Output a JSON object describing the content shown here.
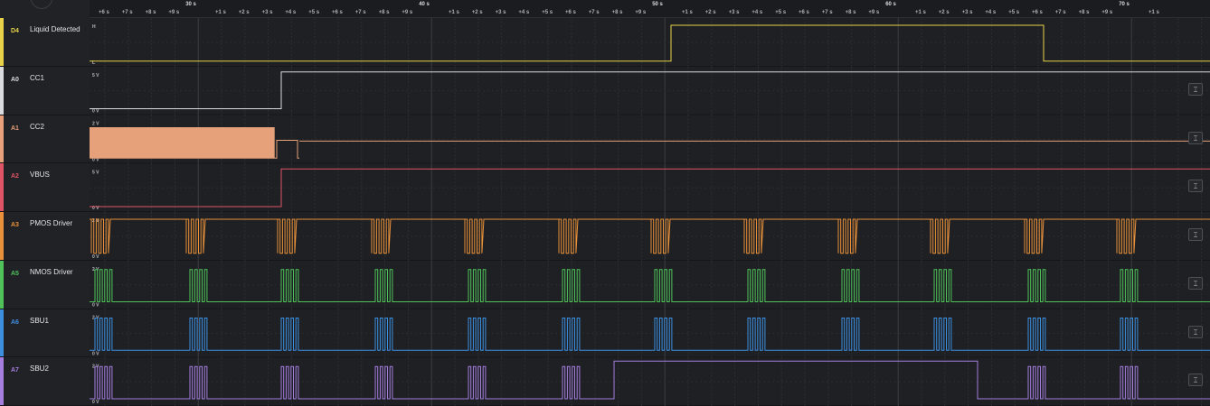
{
  "timeline": {
    "major": [
      "30 s",
      "40 s",
      "50 s",
      "60 s",
      "70 s"
    ],
    "minor": [
      "+6 s",
      "+7 s",
      "+8 s",
      "+9 s",
      "+1 s",
      "+2 s",
      "+3 s",
      "+4 s",
      "+5 s",
      "+6 s",
      "+7 s",
      "+8 s",
      "+9 s",
      "+1 s",
      "+2 s",
      "+3 s",
      "+4 s",
      "+5 s",
      "+6 s",
      "+7 s",
      "+8 s",
      "+9 s",
      "+1 s",
      "+2 s",
      "+3 s",
      "+4 s",
      "+5 s",
      "+6 s",
      "+7 s",
      "+8 s",
      "+9 s",
      "+1 s",
      "+2 s",
      "+3 s",
      "+4 s",
      "+5 s",
      "+6 s",
      "+7 s",
      "+8 s",
      "+9 s",
      "+1 s"
    ]
  },
  "channels": [
    {
      "id": "D4",
      "name": "Liquid Detected",
      "color": "#e8d24a",
      "hi_label": "H",
      "lo_label": "L",
      "type": "digital",
      "expand_icon": false
    },
    {
      "id": "A0",
      "name": "CC1",
      "color": "#d9dbdf",
      "hi_label": "5 V",
      "lo_label": "0 V",
      "type": "step",
      "expand_icon": true
    },
    {
      "id": "A1",
      "name": "CC2",
      "color": "#e6a07a",
      "hi_label": "2 V",
      "lo_label": "0 V",
      "type": "dense",
      "expand_icon": true
    },
    {
      "id": "A2",
      "name": "VBUS",
      "color": "#e05468",
      "hi_label": "5 V",
      "lo_label": "0 V",
      "type": "step",
      "expand_icon": true
    },
    {
      "id": "A3",
      "name": "PMOS Driver",
      "color": "#e8913a",
      "hi_label": "2 V",
      "lo_label": "0 V",
      "type": "burst_hi",
      "expand_icon": true
    },
    {
      "id": "A5",
      "name": "NMOS Driver",
      "color": "#4fc35a",
      "hi_label": "2 V",
      "lo_label": "0 V",
      "type": "burst_lo",
      "expand_icon": true
    },
    {
      "id": "A6",
      "name": "SBU1",
      "color": "#3d8fe0",
      "hi_label": "2 V",
      "lo_label": "0 V",
      "type": "burst_lo",
      "expand_icon": true
    },
    {
      "id": "A7",
      "name": "SBU2",
      "color": "#a57ee0",
      "hi_label": "2 V",
      "lo_label": "0 V",
      "type": "burst_sbu2",
      "expand_icon": true
    }
  ],
  "expand_icon_glyph": "⌶",
  "colors": {
    "background": "#1e1f22",
    "grid": "#34373c",
    "grid_dashed": "#2c2f34"
  }
}
